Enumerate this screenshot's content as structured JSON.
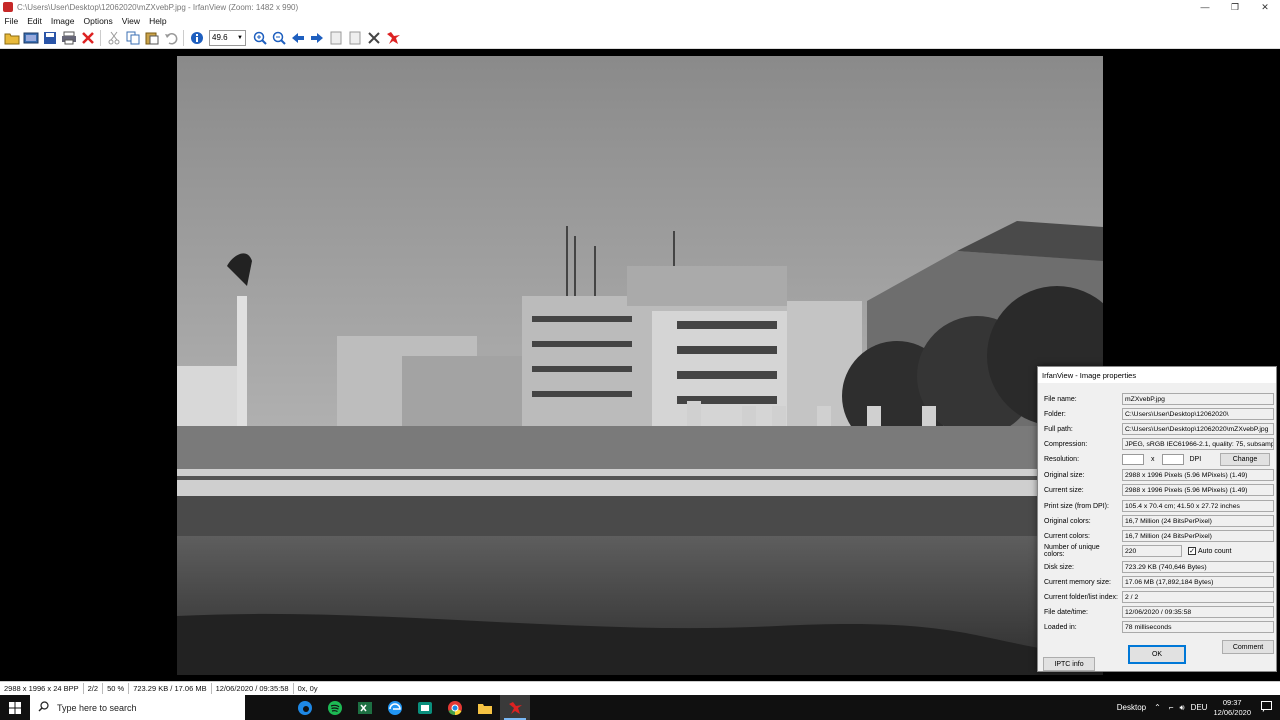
{
  "window": {
    "title": "C:\\Users\\User\\Desktop\\12062020\\mZXvebP.jpg - IrfanView (Zoom: 1482 x 990)",
    "minimize": "—",
    "maximize": "❐",
    "close": "✕"
  },
  "menu": [
    "File",
    "Edit",
    "Image",
    "Options",
    "View",
    "Help"
  ],
  "toolbar": {
    "zoom_value": "49.6",
    "icons": [
      "open-icon",
      "slideshow-icon",
      "save-icon",
      "print-icon",
      "delete-icon",
      "cut-icon",
      "copy-icon",
      "paste-icon",
      "undo-icon",
      "info-icon",
      "zoom-in-icon",
      "zoom-out-icon",
      "previous-icon",
      "next-icon",
      "first-page-icon",
      "last-page-icon",
      "settings-icon",
      "exit-icon"
    ]
  },
  "statusbar": {
    "dimensions": "2988 x 1996 x 24 BPP",
    "index": "2/2",
    "zoom": "50 %",
    "size": "723.29 KB / 17.06 MB",
    "datetime": "12/06/2020 / 09:35:58",
    "coords": "0x, 0y"
  },
  "dialog": {
    "title": "IrfanView - Image properties",
    "rows": [
      {
        "label": "File name:",
        "value": "mZXvebP.jpg"
      },
      {
        "label": "Folder:",
        "value": "C:\\Users\\User\\Desktop\\12062020\\"
      },
      {
        "label": "Full path:",
        "value": "C:\\Users\\User\\Desktop\\12062020\\mZXvebP.jpg"
      },
      {
        "label": "Compression:",
        "value": "JPEG, sRGB IEC61966-2.1, quality: 75, subsampli"
      },
      {
        "label": "Original size:",
        "value": "2988 x 1996  Pixels (5.96 MPixels) (1.49)"
      },
      {
        "label": "Current size:",
        "value": "2988 x 1996  Pixels (5.96 MPixels) (1.49)"
      },
      {
        "label": "Print size (from DPI):",
        "value": "105.4 x 70.4 cm; 41.50 x 27.72 inches"
      },
      {
        "label": "Original colors:",
        "value": "16,7 Million   (24 BitsPerPixel)"
      },
      {
        "label": "Current colors:",
        "value": "16,7 Million   (24 BitsPerPixel)"
      },
      {
        "label": "Disk size:",
        "value": "723.29 KB (740,646 Bytes)"
      },
      {
        "label": "Current memory size:",
        "value": "17.06  MB (17,892,184 Bytes)"
      },
      {
        "label": "Current folder/list index:",
        "value": "2  /  2"
      },
      {
        "label": "File date/time:",
        "value": "12/06/2020 / 09:35:58"
      },
      {
        "label": "Loaded in:",
        "value": "78 milliseconds"
      }
    ],
    "resolution_label": "Resolution:",
    "resolution_x": "x",
    "resolution_unit": "DPI",
    "change_button": "Change",
    "unique_colors_label": "Number of unique colors:",
    "unique_colors_value": "220",
    "auto_count_label": "Auto count",
    "auto_count_checked": true,
    "comment_button": "Comment",
    "iptc_button": "IPTC info",
    "ok_button": "OK"
  },
  "taskbar": {
    "search_placeholder": "Type here to search",
    "desktop_label": "Desktop",
    "language": "DEU",
    "time": "09:37",
    "date": "12/06/2020",
    "apps": [
      "edge-legacy-icon",
      "spotify-icon",
      "excel-icon",
      "edge-icon",
      "app-icon",
      "chrome-icon",
      "file-explorer-icon",
      "irfanview-icon"
    ]
  },
  "colors": {
    "accent": "#0078d7",
    "taskbar": "#101010"
  }
}
